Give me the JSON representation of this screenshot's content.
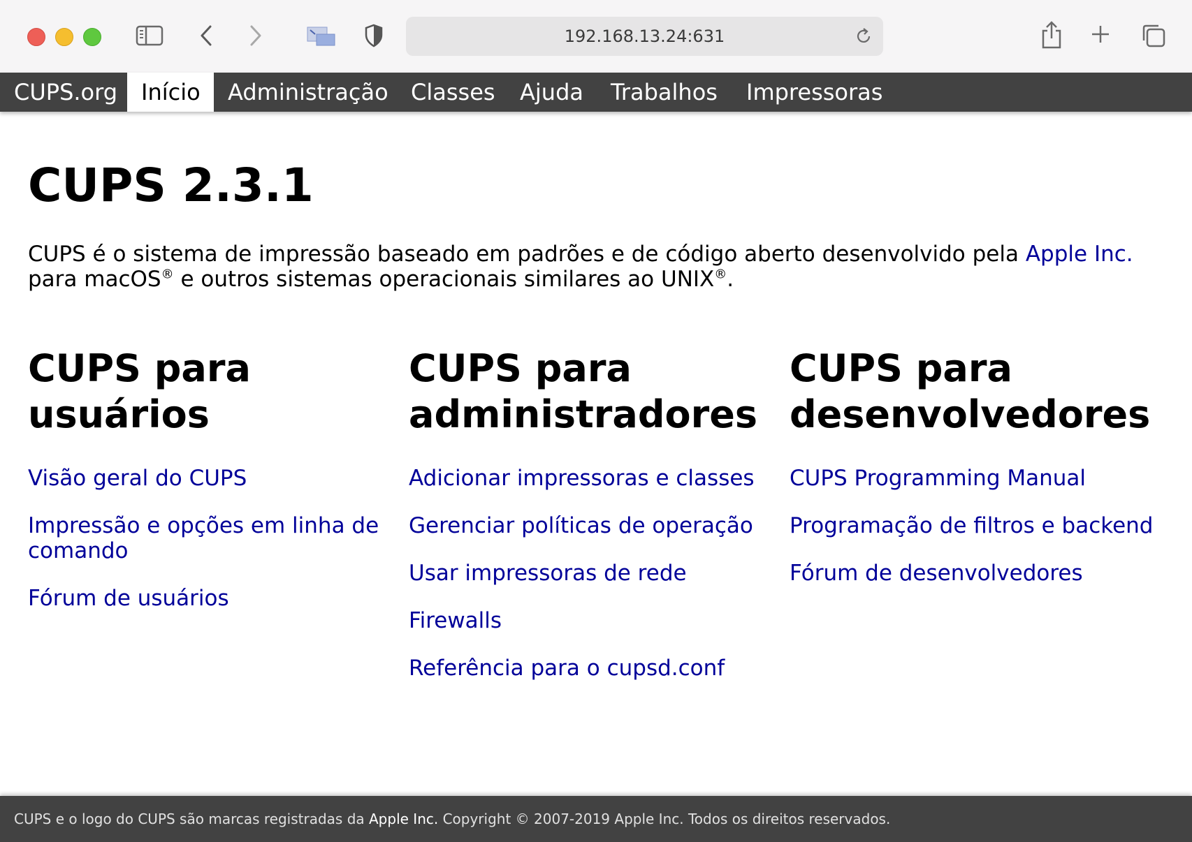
{
  "browser": {
    "url": "192.168.13.24:631",
    "icons": {
      "sidebar": "sidebar-icon",
      "back": "chevron-left-icon",
      "forward": "chevron-right-icon",
      "screen": "screen-share-icon",
      "privacy": "shield-icon",
      "reload": "reload-icon",
      "share": "share-icon",
      "new_tab": "plus-icon",
      "tabs": "tabs-overview-icon"
    }
  },
  "nav": {
    "items": [
      {
        "label": "CUPS.org"
      },
      {
        "label": "Início"
      },
      {
        "label": "Administração"
      },
      {
        "label": "Classes"
      },
      {
        "label": "Ajuda"
      },
      {
        "label": "Trabalhos"
      },
      {
        "label": "Impressoras"
      }
    ]
  },
  "main": {
    "title": "CUPS 2.3.1",
    "intro": {
      "text1": "CUPS é o sistema de impressão baseado em padrões e de código aberto desenvolvido pela ",
      "link": "Apple Inc.",
      "text2": " para macOS",
      "reg": "®",
      "text3": " e outros sistemas operacionais similares ao UNIX",
      "text4": "."
    },
    "columns": [
      {
        "title_line1": "CUPS para",
        "title_line2": "usuários",
        "links": [
          "Visão geral do CUPS",
          "Impressão e opções em linha de comando",
          "Fórum de usuários"
        ]
      },
      {
        "title_line1": "CUPS para",
        "title_line2": "administradores",
        "links": [
          "Adicionar impressoras e classes",
          "Gerenciar políticas de operação",
          "Usar impressoras de rede",
          "Firewalls",
          "Referência para o cupsd.conf"
        ]
      },
      {
        "title_line1": "CUPS para",
        "title_line2": "desenvolvedores",
        "links": [
          "CUPS Programming Manual",
          "Programação de filtros e backend",
          "Fórum de desenvolvedores"
        ]
      }
    ]
  },
  "footer": {
    "text1": "CUPS e o logo do CUPS são marcas registradas da ",
    "highlight": "Apple Inc.",
    "text2": " Copyright © 2007-2019 Apple Inc. Todos os direitos reservados."
  }
}
